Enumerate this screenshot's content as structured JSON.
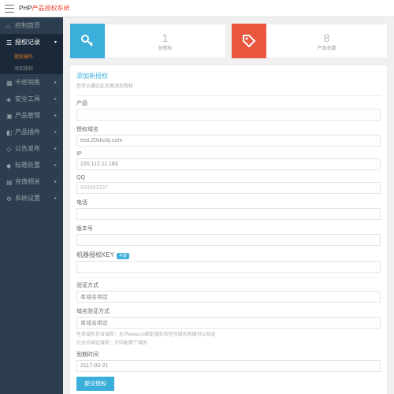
{
  "brand": {
    "part1": "PHP",
    "part2": "产品授权系统"
  },
  "sidebar": {
    "items": [
      {
        "label": "控制首页"
      },
      {
        "label": "授权记录",
        "expanded": true,
        "subs": [
          {
            "label": "授权操作",
            "active": true
          },
          {
            "label": "添加授权"
          }
        ]
      },
      {
        "label": "卡密销售"
      },
      {
        "label": "安全工具"
      },
      {
        "label": "产品管理"
      },
      {
        "label": "产品插件"
      },
      {
        "label": "公告发布"
      },
      {
        "label": "标题处置"
      },
      {
        "label": "充值相关"
      },
      {
        "label": "系统设置"
      }
    ]
  },
  "cards": [
    {
      "num": "1",
      "label": "总授权"
    },
    {
      "num": "8",
      "label": "产品总数"
    }
  ],
  "panel": {
    "title": "添加新授权",
    "subtitle": "您可以通过此页面添加授权"
  },
  "form": {
    "product_label": "产品",
    "domain_label": "授权域名",
    "domain_value": "test.20skcity.com",
    "ip_label": "IP",
    "ip_value": "220.112.11.183",
    "qq_label": "QQ",
    "qq_placeholder": "634563157",
    "phone_label": "电话",
    "version_label": "版本号",
    "key_label": "机器授权KEY",
    "key_badge": "可留",
    "verify_label": "验证方式",
    "verify_value": "单域名绑定",
    "domain_verify_label": "域名验证方式",
    "domain_verify_value": "单域名绑定",
    "domain_verify_hint": "任意域名包含域名：允许www.cn绑定域名的任何域名前缀可以验证",
    "domain_verify_hint2": "只允许绑定域名：只匹配单个域名",
    "date_label": "到期时间",
    "date_value": "2117-03-21",
    "submit": "提交授权"
  }
}
